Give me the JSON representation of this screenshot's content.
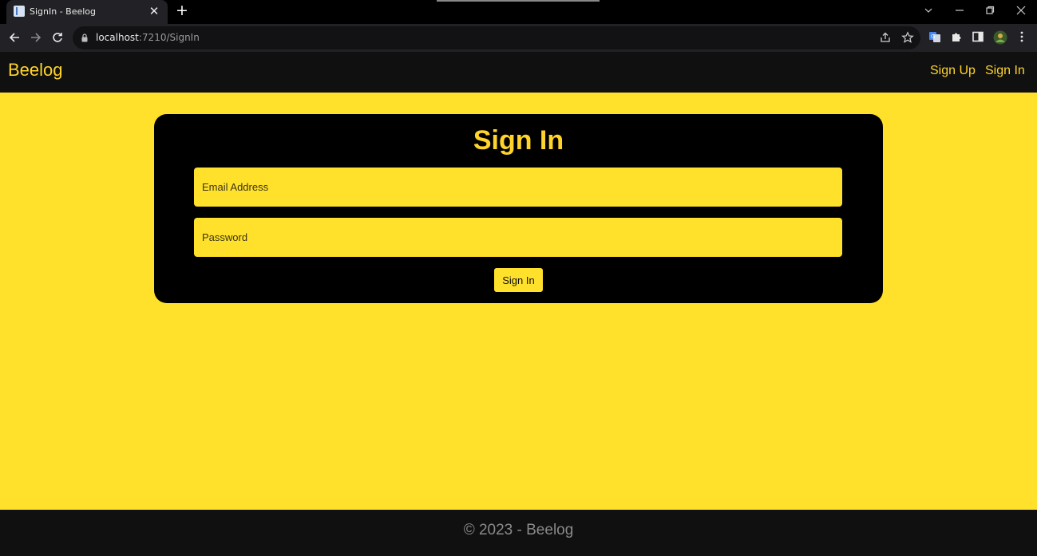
{
  "browser": {
    "tab_title": "SignIn - Beelog",
    "close_glyph": "✕",
    "new_tab_glyph": "+",
    "url_host": "localhost",
    "url_path": ":7210/SignIn",
    "icons": [
      "back-arrow-icon",
      "forward-arrow-icon",
      "reload-icon",
      "lock-icon",
      "share-icon",
      "star-icon",
      "translate-extension-icon",
      "puzzle-extension-icon",
      "side-panel-icon",
      "profile-avatar-icon",
      "more-menu-icon"
    ]
  },
  "navbar": {
    "brand": "Beelog",
    "links": [
      "Sign Up",
      "Sign In"
    ]
  },
  "form": {
    "title": "Sign In",
    "email_placeholder": "Email Address",
    "password_placeholder": "Password",
    "submit_label": "Sign In"
  },
  "footer": {
    "text": "© 2023 - Beelog"
  },
  "colors": {
    "accent": "#ffe02a",
    "navbar_bg": "#101010",
    "card_bg": "#000000",
    "link_text": "#ffd42a"
  }
}
